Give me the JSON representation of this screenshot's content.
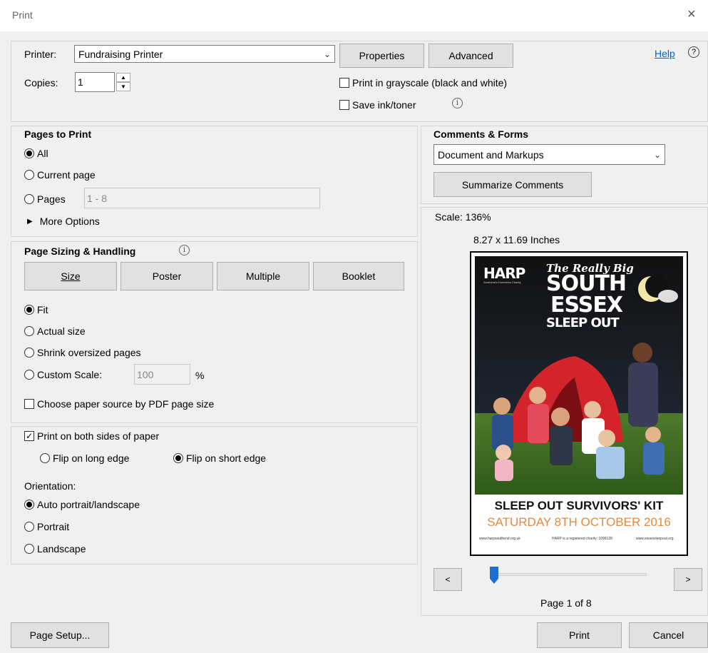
{
  "window": {
    "title": "Print",
    "close_symbol": "×"
  },
  "printer": {
    "label": "Printer:",
    "value": "Fundraising Printer",
    "properties_label": "Properties",
    "advanced_label": "Advanced",
    "help_label": "Help",
    "copies_label": "Copies:",
    "copies_value": "1",
    "grayscale_label": "Print in grayscale (black and white)",
    "save_ink_label": "Save ink/toner"
  },
  "pages_to_print": {
    "heading": "Pages to Print",
    "all_label": "All",
    "current_label": "Current page",
    "pages_label": "Pages",
    "pages_value": "1 - 8",
    "more_options_label": "More Options"
  },
  "sizing": {
    "heading": "Page Sizing & Handling",
    "tabs": [
      "Size",
      "Poster",
      "Multiple",
      "Booklet"
    ],
    "fit_label": "Fit",
    "actual_label": "Actual size",
    "shrink_label": "Shrink oversized pages",
    "custom_label": "Custom Scale:",
    "custom_value": "100",
    "percent": "%",
    "paper_source_label": "Choose paper source by PDF page size"
  },
  "duplex": {
    "both_sides_label": "Print on both sides of paper",
    "long_edge_label": "Flip on long edge",
    "short_edge_label": "Flip on short edge",
    "orientation_label": "Orientation:",
    "auto_label": "Auto portrait/landscape",
    "portrait_label": "Portrait",
    "landscape_label": "Landscape"
  },
  "comments": {
    "heading": "Comments & Forms",
    "value": "Document and Markups",
    "summarize_label": "Summarize Comments"
  },
  "preview": {
    "scale": "Scale: 136%",
    "dimensions": "8.27 x 11.69 Inches",
    "page_indicator": "Page 1 of 8",
    "prev_label": "<",
    "next_label": ">",
    "slider_fraction": 0.0,
    "poster": {
      "harp": "HARP",
      "harp_sub": "Southend's Homeless Charity",
      "tagline": "The Really Big",
      "line1": "SOUTH",
      "line2": "ESSEX",
      "line3": "SLEEP OUT",
      "kit": "SLEEP OUT SURVIVORS' KIT",
      "date": "SATURDAY 8TH OCTOBER 2016",
      "footer_left": "www.harpsouthend.org.uk",
      "footer_mid": "HARP is a registered charity: 1098128",
      "footer_right": "www.essexsleepout.org"
    }
  },
  "footer": {
    "page_setup_label": "Page Setup...",
    "print_label": "Print",
    "cancel_label": "Cancel"
  },
  "colors": {
    "accent": "#0066cc",
    "date_orange": "#e8893a"
  }
}
